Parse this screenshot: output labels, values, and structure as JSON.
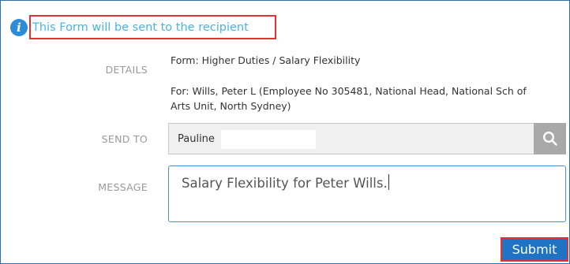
{
  "banner": {
    "icon": "info-icon",
    "icon_glyph": "i",
    "text": "This Form will be sent to the recipient",
    "icon_color": "#2e8bd8",
    "text_color": "#49b3e8",
    "highlight_color": "#e03434"
  },
  "details": {
    "label": "DETAILS",
    "form_line": "Form: Higher Duties / Salary Flexibility",
    "for_line_1": "For: Wills, Peter L (Employee No 305481, National Head, National Sch of",
    "for_line_2": "Arts Unit, North Sydney)"
  },
  "send_to": {
    "label": "SEND TO",
    "value": "Pauline",
    "search_icon": "search-icon"
  },
  "message": {
    "label": "MESSAGE",
    "value": "Salary Flexibility for Peter Wills."
  },
  "actions": {
    "submit_label": "Submit",
    "submit_color": "#1f73c4"
  }
}
